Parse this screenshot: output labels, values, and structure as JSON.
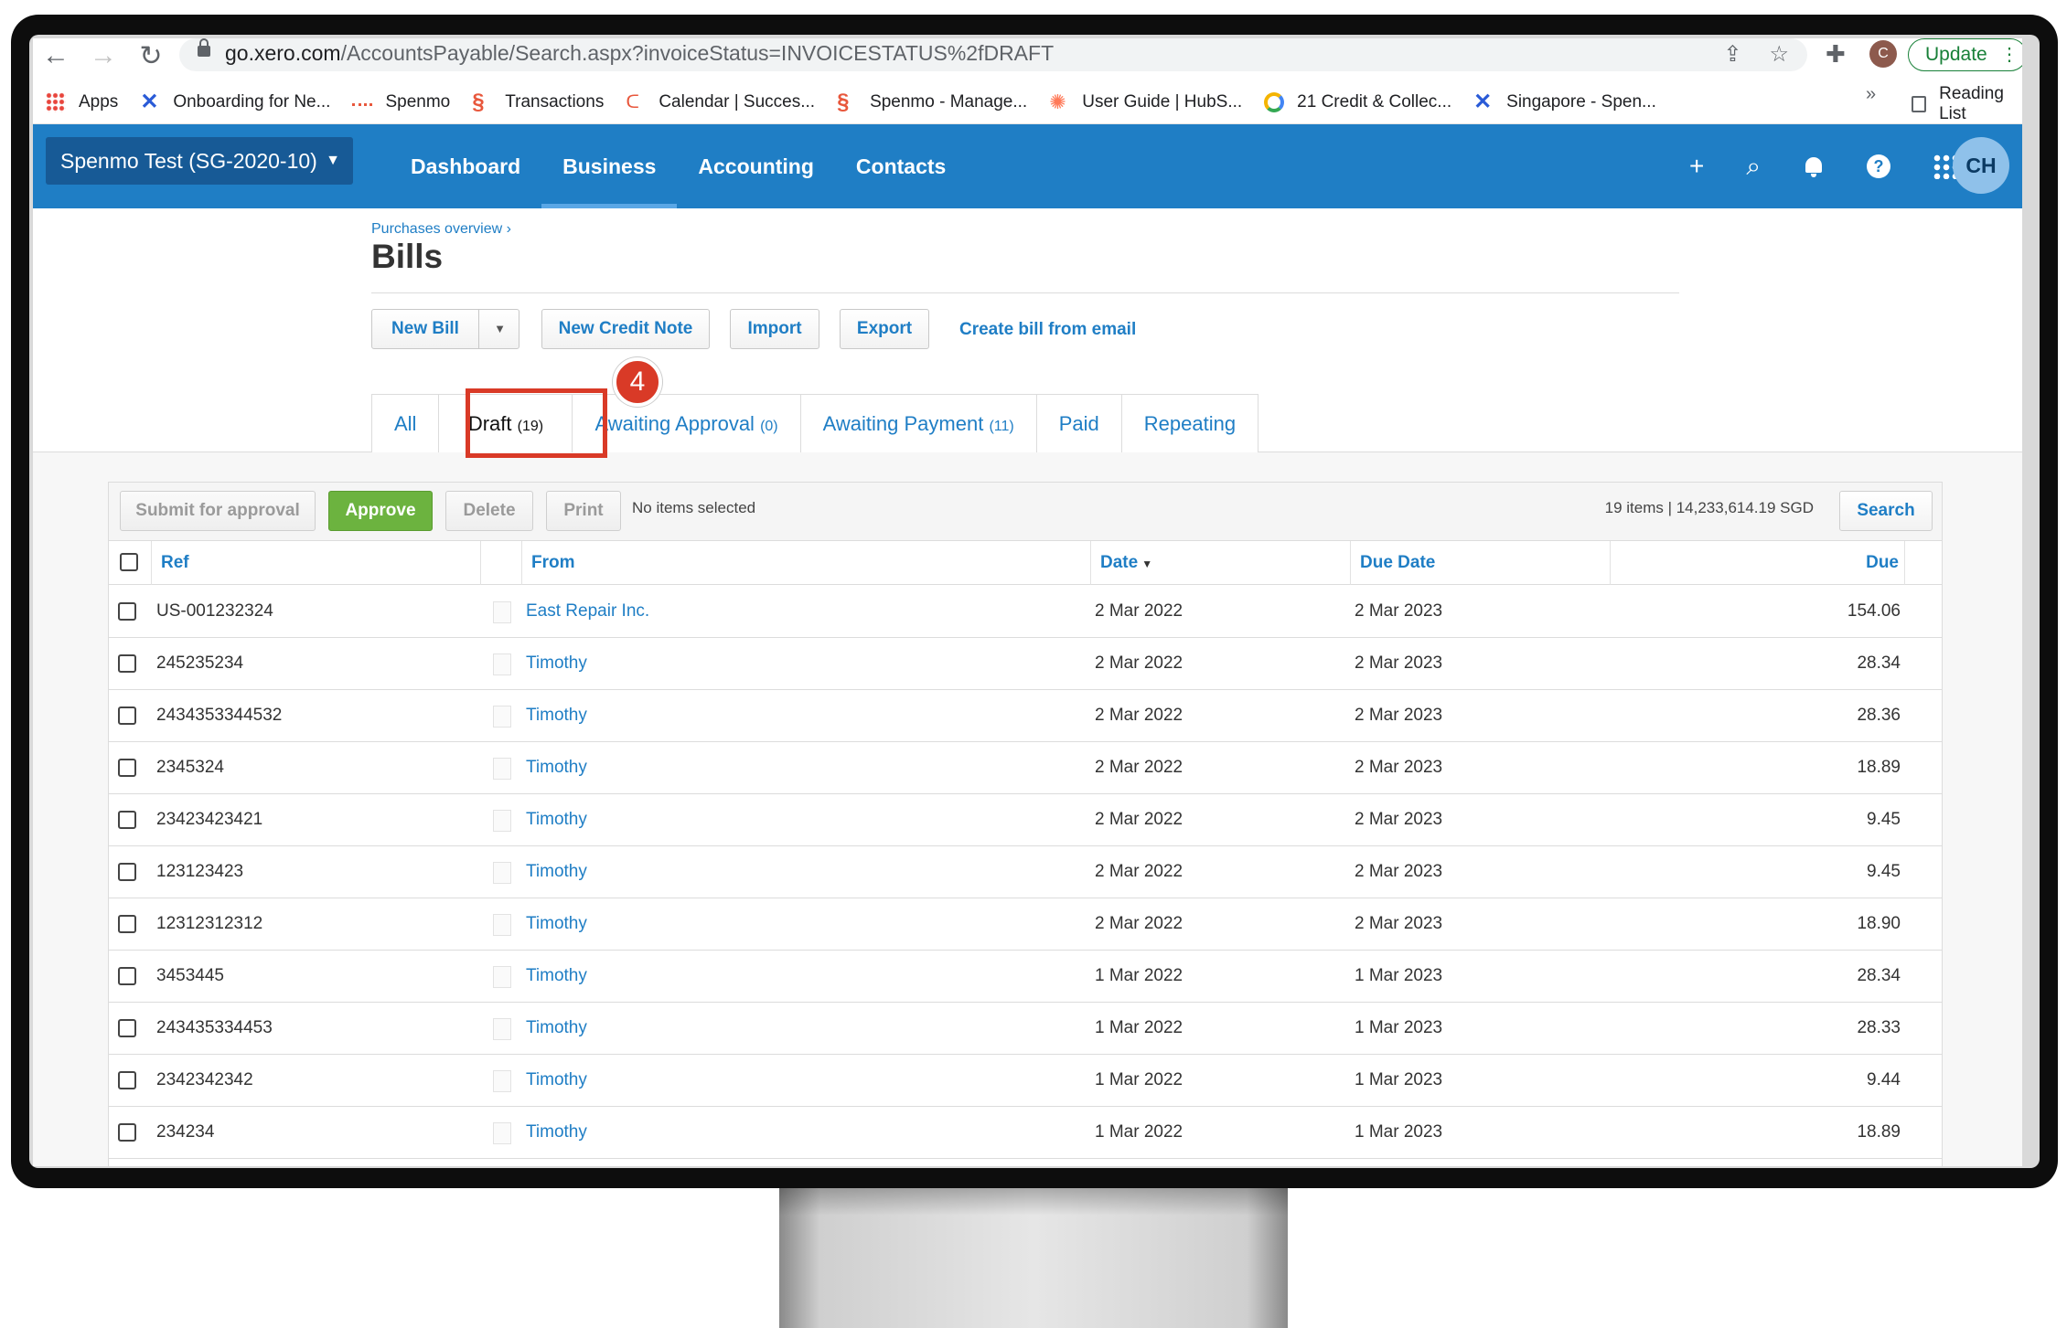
{
  "browser": {
    "url_host": "go.xero.com",
    "url_path": "/AccountsPayable/Search.aspx?invoiceStatus=INVOICESTATUS%2fDRAFT",
    "profile_initial": "C",
    "update_label": "Update",
    "bookmarks": [
      {
        "label": "Apps",
        "icon": "apps-grid-icon"
      },
      {
        "label": "Onboarding for Ne...",
        "icon": "x-logo-icon"
      },
      {
        "label": "Spenmo",
        "icon": "dash-logo-icon"
      },
      {
        "label": "Transactions",
        "icon": "spenmo-logo-icon"
      },
      {
        "label": "Calendar | Succes...",
        "icon": "calendar-logo-icon"
      },
      {
        "label": "Spenmo - Manage...",
        "icon": "spenmo-logo-icon"
      },
      {
        "label": "User Guide | HubS...",
        "icon": "hubspot-logo-icon"
      },
      {
        "label": "21 Credit & Collec...",
        "icon": "ring-logo-icon"
      },
      {
        "label": "Singapore - Spen...",
        "icon": "x-logo-icon"
      }
    ],
    "more_label": "»",
    "reading_list_label": "Reading List"
  },
  "header": {
    "org_name": "Spenmo Test (SG-2020-10)",
    "nav": [
      "Dashboard",
      "Business",
      "Accounting",
      "Contacts"
    ],
    "active_nav": "Business",
    "avatar_initials": "CH"
  },
  "page": {
    "breadcrumb": "Purchases overview ›",
    "title": "Bills",
    "actions": {
      "new_bill": "New Bill",
      "new_credit_note": "New Credit Note",
      "import": "Import",
      "export": "Export",
      "create_from_email": "Create bill from email"
    },
    "tabs": [
      {
        "label": "All",
        "count": ""
      },
      {
        "label": "Draft",
        "count": "(19)"
      },
      {
        "label": "Awaiting Approval",
        "count": "(0)"
      },
      {
        "label": "Awaiting Payment",
        "count": "(11)"
      },
      {
        "label": "Paid",
        "count": ""
      },
      {
        "label": "Repeating",
        "count": ""
      }
    ],
    "active_tab": "Draft",
    "step_badge": "4",
    "highlight_color": "#d93a27"
  },
  "toolbar": {
    "submit_label": "Submit for approval",
    "approve_label": "Approve",
    "delete_label": "Delete",
    "print_label": "Print",
    "selection_text": "No items selected",
    "summary": "19 items | 14,233,614.19 SGD",
    "search_label": "Search"
  },
  "table": {
    "columns": {
      "ref": "Ref",
      "from": "From",
      "date": "Date",
      "due_date": "Due Date",
      "due": "Due"
    },
    "rows": [
      {
        "ref": "US-001232324",
        "from": "East Repair Inc.",
        "date": "2 Mar 2022",
        "due_date": "2 Mar 2023",
        "due": "154.06"
      },
      {
        "ref": "245235234",
        "from": "Timothy",
        "date": "2 Mar 2022",
        "due_date": "2 Mar 2023",
        "due": "28.34"
      },
      {
        "ref": "2434353344532",
        "from": "Timothy",
        "date": "2 Mar 2022",
        "due_date": "2 Mar 2023",
        "due": "28.36"
      },
      {
        "ref": "2345324",
        "from": "Timothy",
        "date": "2 Mar 2022",
        "due_date": "2 Mar 2023",
        "due": "18.89"
      },
      {
        "ref": "23423423421",
        "from": "Timothy",
        "date": "2 Mar 2022",
        "due_date": "2 Mar 2023",
        "due": "9.45"
      },
      {
        "ref": "123123423",
        "from": "Timothy",
        "date": "2 Mar 2022",
        "due_date": "2 Mar 2023",
        "due": "9.45"
      },
      {
        "ref": "12312312312",
        "from": "Timothy",
        "date": "2 Mar 2022",
        "due_date": "2 Mar 2023",
        "due": "18.90"
      },
      {
        "ref": "3453445",
        "from": "Timothy",
        "date": "1 Mar 2022",
        "due_date": "1 Mar 2023",
        "due": "28.34"
      },
      {
        "ref": "243435334453",
        "from": "Timothy",
        "date": "1 Mar 2022",
        "due_date": "1 Mar 2023",
        "due": "28.33"
      },
      {
        "ref": "2342342342",
        "from": "Timothy",
        "date": "1 Mar 2022",
        "due_date": "1 Mar 2023",
        "due": "9.44"
      },
      {
        "ref": "234234",
        "from": "Timothy",
        "date": "1 Mar 2022",
        "due_date": "1 Mar 2023",
        "due": "18.89"
      }
    ]
  },
  "colors": {
    "xero_blue": "#1f7ec5",
    "approve_green": "#6cb33f",
    "org_button": "#175a96"
  }
}
